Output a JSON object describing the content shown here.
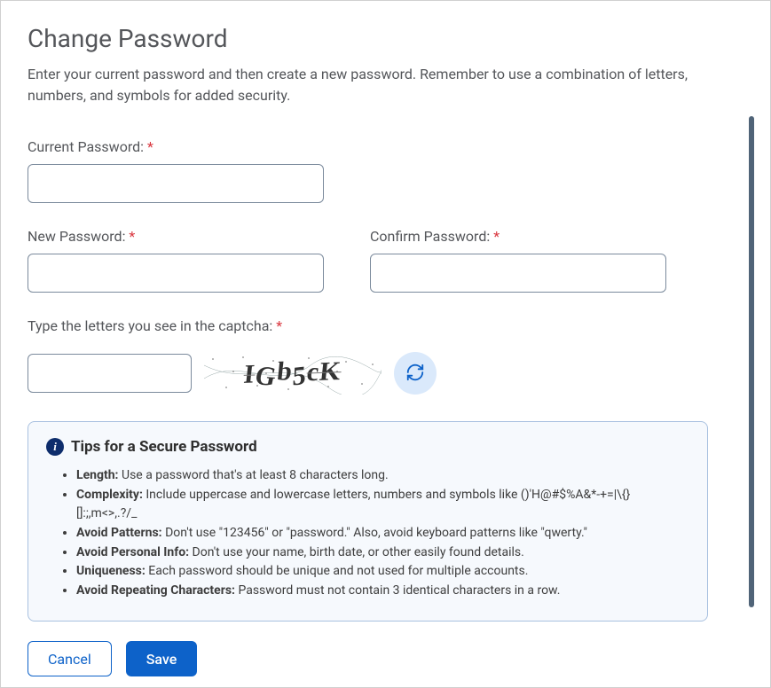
{
  "heading": "Change Password",
  "subtitle": "Enter your current password and then create a new password. Remember to use a combination of letters, numbers, and symbols for added security.",
  "fields": {
    "current": {
      "label": "Current Password:",
      "value": ""
    },
    "new": {
      "label": "New Password:",
      "value": ""
    },
    "confirm": {
      "label": "Confirm Password:",
      "value": ""
    },
    "captcha": {
      "label": "Type the letters you see in the captcha:",
      "value": ""
    }
  },
  "required_marker": "*",
  "captcha_text": "IGb5cK",
  "tips": {
    "title": "Tips for a Secure Password",
    "items": [
      {
        "label": "Length:",
        "text": " Use a password that's at least 8 characters long."
      },
      {
        "label": "Complexity:",
        "text": " Include uppercase and lowercase letters, numbers and symbols like ()'H@#$%A&*-+=|\\{}[]:;,m<>,.?/_"
      },
      {
        "label": "Avoid Patterns:",
        "text": " Don't use \"123456\" or \"password.\" Also, avoid keyboard patterns like \"qwerty.\""
      },
      {
        "label": "Avoid Personal Info:",
        "text": " Don't use your name, birth date, or other easily found details."
      },
      {
        "label": "Uniqueness:",
        "text": " Each password should be unique and not used for multiple accounts."
      },
      {
        "label": "Avoid Repeating Characters:",
        "text": " Password must not contain 3 identical characters in a row."
      }
    ]
  },
  "buttons": {
    "cancel": "Cancel",
    "save": "Save"
  }
}
